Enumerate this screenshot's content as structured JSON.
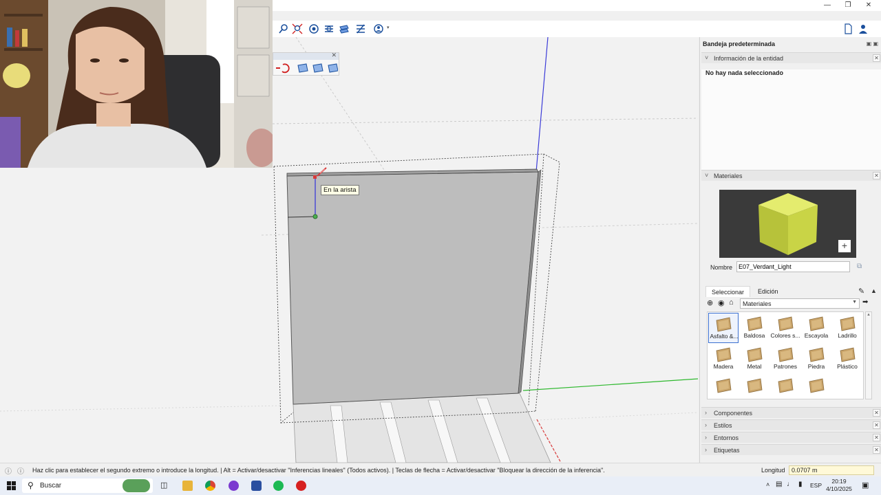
{
  "viewport": {
    "tooltip": "En la arista"
  },
  "tray": {
    "title": "Bandeja predeterminada",
    "entity_info": {
      "label": "Información de la entidad",
      "message": "No hay nada seleccionado"
    },
    "materials": {
      "label": "Materiales",
      "name_label": "Nombre",
      "name_value": "E07_Verdant_Light",
      "tabs": [
        "Seleccionar",
        "Edición"
      ],
      "active_tab": "Seleccionar",
      "library": "Materiales",
      "preview_color": "#d6e04a",
      "items": [
        {
          "label": "Asfalto &..."
        },
        {
          "label": "Baldosa"
        },
        {
          "label": "Colores s..."
        },
        {
          "label": "Escayola"
        },
        {
          "label": "Ladrillo"
        },
        {
          "label": "Madera"
        },
        {
          "label": "Metal"
        },
        {
          "label": "Patrones"
        },
        {
          "label": "Piedra"
        },
        {
          "label": "Plástico"
        }
      ]
    },
    "collapsed_panels": [
      {
        "label": "Componentes"
      },
      {
        "label": "Estilos"
      },
      {
        "label": "Entornos"
      },
      {
        "label": "Etiquetas"
      }
    ]
  },
  "statusbar": {
    "hint": "Haz clic para establecer el segundo extremo o introduce la longitud. | Alt = Activar/desactivar \"Inferencias lineales\" (Todos activos). | Teclas de flecha = Activar/desactivar \"Bloquear la dirección de la inferencia\".",
    "vcb_label": "Longitud",
    "vcb_value": "0.0707 m"
  },
  "taskbar": {
    "search_placeholder": "Buscar",
    "language": "ESP",
    "time": "20:19",
    "date": "4/10/2025"
  },
  "colors": {
    "axis_blue": "#3a3ad8",
    "axis_green": "#2db82d",
    "axis_red": "#d83a3a",
    "wall_face": "#bdbdbd",
    "selection_accent": "#3a6fd0"
  },
  "icons": {
    "toolbar": [
      "zoom-icon",
      "zoom-extents-icon",
      "section-plane-icon",
      "section-display-icon",
      "section-cuts-icon",
      "section-fill-icon",
      "account-icon"
    ],
    "window": [
      "minimize-icon",
      "restore-icon",
      "close-icon"
    ]
  }
}
